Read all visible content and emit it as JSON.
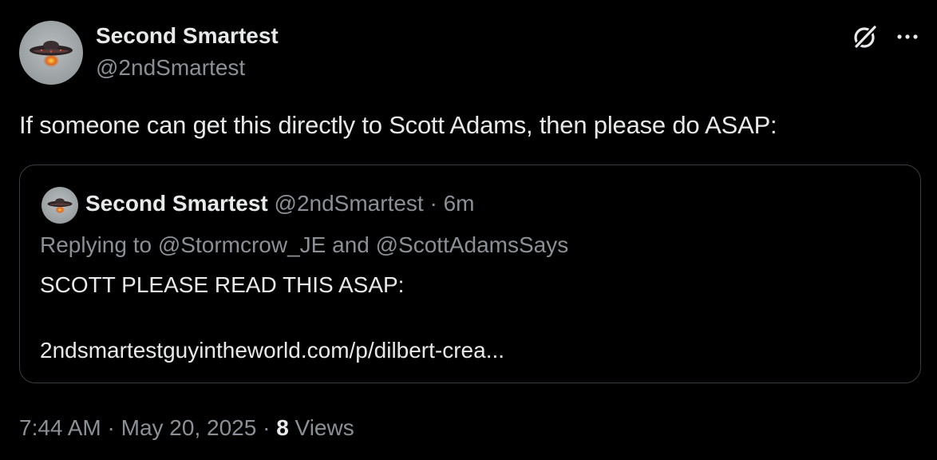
{
  "post": {
    "author": {
      "name": "Second Smartest",
      "handle": "@2ndSmartest",
      "avatar_icon": "ufo-avatar"
    },
    "text": "If someone can get this directly to Scott Adams, then please do ASAP:",
    "header_icons": [
      "grok-icon",
      "more-icon"
    ]
  },
  "quote": {
    "author_name": "Second Smartest",
    "handle": "@2ndSmartest",
    "separator": " · ",
    "time_ago": "6m",
    "replying_prefix": "Replying to ",
    "replying_user_1": "@Stormcrow_JE",
    "replying_and": " and ",
    "replying_user_2": "@ScottAdamsSays",
    "body": "SCOTT PLEASE READ THIS ASAP:",
    "link": "2ndsmartestguyintheworld.com/p/dilbert-crea..."
  },
  "footer": {
    "time": "7:44 AM",
    "separator_1": " · ",
    "date": "May 20, 2025",
    "separator_2": " · ",
    "views_count": "8",
    "views_label": " Views"
  },
  "colors": {
    "background": "#000000",
    "primary_text": "#e7e9ea",
    "secondary_text": "#8b9096",
    "border": "#3a3d41"
  }
}
